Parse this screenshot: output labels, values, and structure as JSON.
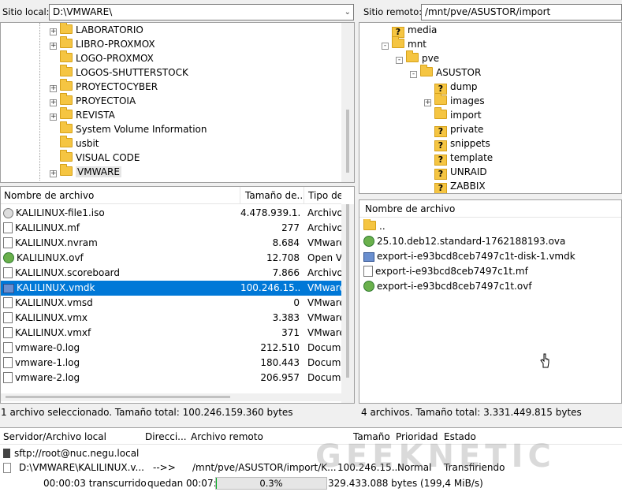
{
  "local": {
    "site_label": "Sitio local:",
    "path": "D:\\VMWARE\\",
    "tree": [
      {
        "name": "LABORATORIO",
        "expander": "+"
      },
      {
        "name": "LIBRO-PROXMOX",
        "expander": "+"
      },
      {
        "name": "LOGO-PROXMOX",
        "expander": ""
      },
      {
        "name": "LOGOS-SHUTTERSTOCK",
        "expander": ""
      },
      {
        "name": "PROYECTOCYBER",
        "expander": "+"
      },
      {
        "name": "PROYECTOIA",
        "expander": "+"
      },
      {
        "name": "REVISTA",
        "expander": "+"
      },
      {
        "name": "System Volume Information",
        "expander": ""
      },
      {
        "name": "usbit",
        "expander": ""
      },
      {
        "name": "VISUAL CODE",
        "expander": ""
      },
      {
        "name": "VMWARE",
        "expander": "+"
      }
    ],
    "columns": {
      "name": "Nombre de archivo",
      "size": "Tamaño de...",
      "type": "Tipo de"
    },
    "files": [
      {
        "name": "KALILINUX-file1.iso",
        "size": "4.478.939.1...",
        "type": "Archivo",
        "icon": "disk-icon"
      },
      {
        "name": "KALILINUX.mf",
        "size": "277",
        "type": "Archivo",
        "icon": "file-icon"
      },
      {
        "name": "KALILINUX.nvram",
        "size": "8.684",
        "type": "VMware",
        "icon": "file-icon"
      },
      {
        "name": "KALILINUX.ovf",
        "size": "12.708",
        "type": "Open Vi",
        "icon": "ovf-icon"
      },
      {
        "name": "KALILINUX.scoreboard",
        "size": "7.866",
        "type": "Archivo",
        "icon": "file-icon"
      },
      {
        "name": "KALILINUX.vmdk",
        "size": "100.246.15...",
        "type": "VMware",
        "icon": "vmdk-icon",
        "selected": true
      },
      {
        "name": "KALILINUX.vmsd",
        "size": "0",
        "type": "VMware",
        "icon": "file-icon"
      },
      {
        "name": "KALILINUX.vmx",
        "size": "3.383",
        "type": "VMware",
        "icon": "file-icon"
      },
      {
        "name": "KALILINUX.vmxf",
        "size": "371",
        "type": "VMware",
        "icon": "file-icon"
      },
      {
        "name": "vmware-0.log",
        "size": "212.510",
        "type": "Docume",
        "icon": "log-icon"
      },
      {
        "name": "vmware-1.log",
        "size": "180.443",
        "type": "Docume",
        "icon": "log-icon"
      },
      {
        "name": "vmware-2.log",
        "size": "206.957",
        "type": "Docume",
        "icon": "log-icon"
      }
    ],
    "status": "1 archivo seleccionado. Tamaño total: 100.246.159.360 bytes"
  },
  "remote": {
    "site_label": "Sitio remoto:",
    "path": "/mnt/pve/ASUSTOR/import",
    "tree": [
      {
        "name": "media",
        "level": 0,
        "expander": "",
        "unknown": true
      },
      {
        "name": "mnt",
        "level": 0,
        "expander": "-",
        "unknown": false
      },
      {
        "name": "pve",
        "level": 1,
        "expander": "-",
        "unknown": false
      },
      {
        "name": "ASUSTOR",
        "level": 2,
        "expander": "-",
        "unknown": false
      },
      {
        "name": "dump",
        "level": 3,
        "expander": "",
        "unknown": true
      },
      {
        "name": "images",
        "level": 3,
        "expander": "+",
        "unknown": false
      },
      {
        "name": "import",
        "level": 3,
        "expander": "",
        "unknown": false
      },
      {
        "name": "private",
        "level": 3,
        "expander": "",
        "unknown": true
      },
      {
        "name": "snippets",
        "level": 3,
        "expander": "",
        "unknown": true
      },
      {
        "name": "template",
        "level": 3,
        "expander": "",
        "unknown": true
      },
      {
        "name": "UNRAID",
        "level": 3,
        "expander": "",
        "unknown": true
      },
      {
        "name": "ZABBIX",
        "level": 3,
        "expander": "",
        "unknown": true
      }
    ],
    "columns": {
      "name": "Nombre de archivo"
    },
    "files": [
      {
        "name": "..",
        "icon": "folder-icon"
      },
      {
        "name": "25.10.deb12.standard-1762188193.ova",
        "icon": "ovf-icon"
      },
      {
        "name": "export-i-e93bcd8ceb7497c1t-disk-1.vmdk",
        "icon": "vmdk-icon"
      },
      {
        "name": "export-i-e93bcd8ceb7497c1t.mf",
        "icon": "file-icon"
      },
      {
        "name": "export-i-e93bcd8ceb7497c1t.ovf",
        "icon": "ovf-icon"
      }
    ],
    "status": "4 archivos. Tamaño total: 3.331.449.815 bytes"
  },
  "queue": {
    "columns": {
      "server": "Servidor/Archivo local",
      "direction": "Direcci...",
      "remote": "Archivo remoto",
      "size": "Tamaño",
      "priority": "Prioridad",
      "state": "Estado"
    },
    "server": "sftp://root@nuc.negu.local",
    "local_file": "D:\\VMWARE\\KALILINUX.v...",
    "direction": "-->>",
    "remote_file": "/mnt/pve/ASUSTOR/import/K...",
    "size": "100.246.15...",
    "priority": "Normal",
    "state": "Transfiriendo",
    "elapsed": "00:00:03 transcurrido",
    "remaining": "quedan 00:07:59",
    "progress_text": "0.3%",
    "progress": 0.3,
    "transferred": "329.433.088 bytes (199,4 MiB/s)"
  },
  "watermark": "GEEKNETIC",
  "colors": {
    "selection": "#0078d7",
    "progress": "#06b025",
    "folder": "#f5c542"
  }
}
